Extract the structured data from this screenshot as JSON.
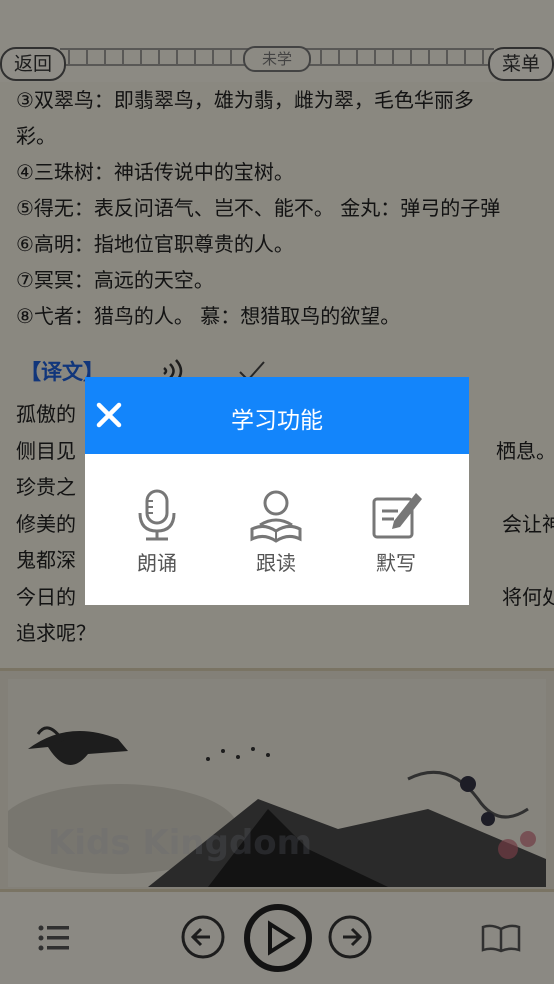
{
  "header": {
    "back_label": "返回",
    "status_label": "未学",
    "menu_label": "菜单"
  },
  "notes": [
    "③双翠鸟：即翡翠鸟，雄为翡，雌为翠，毛色华丽多",
    "彩。",
    "④三珠树：神话传说中的宝树。",
    "⑤得无：表反问语气、岂不、能不。 金丸：弹弓的子弹",
    "⑥高明：指地位官职尊贵的人。",
    "⑦冥冥：高远的天空。",
    "⑧弋者：猎鸟的人。 慕：想猎取鸟的欲望。"
  ],
  "translation": {
    "title": "【译文】",
    "lines": [
      "孤傲的",
      "侧目见",
      "珍贵之",
      "修美的",
      "鬼都深",
      "今日的",
      "追求呢？"
    ],
    "right_fragments": [
      "",
      "栖息。",
      "",
      "会让神",
      "",
      "将何处",
      ""
    ]
  },
  "dialog": {
    "title": "学习功能",
    "functions": [
      {
        "label": "朗诵",
        "icon": "microphone-icon"
      },
      {
        "label": "跟读",
        "icon": "reader-icon"
      },
      {
        "label": "默写",
        "icon": "edit-icon"
      }
    ]
  },
  "painting": {
    "watermark": "Kids Kingdom"
  },
  "colors": {
    "accent": "#1385fb",
    "title_blue": "#1e5fd8",
    "paper": "#f3efe2"
  }
}
